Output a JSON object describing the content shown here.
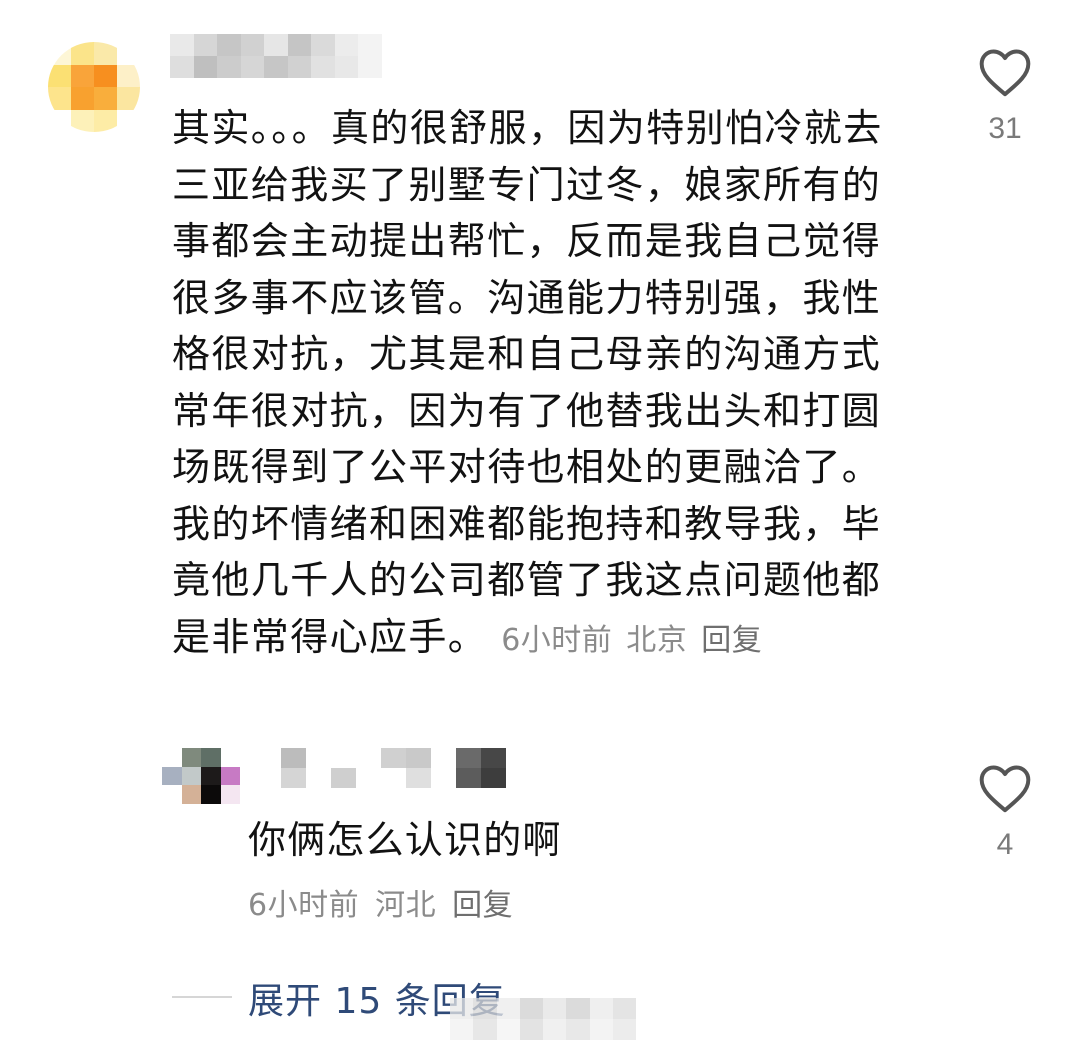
{
  "comments": [
    {
      "text": "其实。。。真的很舒服，因为特别怕冷就去三亚给我买了别墅专门过冬，娘家所有的事都会主动提出帮忙，反而是我自己觉得很多事不应该管。沟通能力特别强，我性格很对抗，尤其是和自己母亲的沟通方式常年很对抗，因为有了他替我出头和打圆场既得到了公平对待也相处的更融洽了。我的坏情绪和困难都能抱持和教导我，毕竟他几千人的公司都管了我这点问题他都是非常得心应手。",
      "time": "6小时前",
      "location": "北京",
      "reply_label": "回复",
      "likes": "31",
      "like_icon": "heart-outline-icon",
      "avatar_pixels": [
        "#fdf6d6",
        "#fbe48a",
        "#fae9a9",
        "#ffffff",
        "#fbe073",
        "#f9a43a",
        "#f78f1f",
        "#fdf0c8",
        "#fde48c",
        "#f8a12f",
        "#f9ae3c",
        "#fbe6a0",
        "#ffffff",
        "#fdf1b9",
        "#fdeca6",
        "#ffffff"
      ],
      "username_pixels": [
        "#e6e6e6",
        "#cfcfcf",
        "#bdbdbd",
        "#c9c9c9",
        "#e2e2e2",
        "#bcbcbc",
        "#d4d4d4",
        "#e9e9e9",
        "#f2f2f2",
        "#d9d9d9",
        "#b5b5b5",
        "#c4c4c4",
        "#d0d0d0",
        "#bdbdbd",
        "#cacaca",
        "#dcdcdc",
        "#e4e4e4",
        "#f2f2f2"
      ]
    },
    {
      "text": "你俩怎么认识的啊",
      "time": "6小时前",
      "location": "河北",
      "reply_label": "回复",
      "likes": "4",
      "like_icon": "heart-outline-icon",
      "avatar_pixels": [
        "#ffffff",
        "#7f8a7d",
        "#5f6f66",
        "#ffffff",
        "#a7b0c0",
        "#c2c9c9",
        "#1d1a1a",
        "#c77ac4",
        "#ffffff",
        "#d4b197",
        "#0c0a0a",
        "#f4e6f1"
      ],
      "username_pixels": [
        "#ffffff",
        "#bcbcbc",
        "#ffffff",
        "#ffffff",
        "#ffffff",
        "#d0d0d0",
        "#c9c9c9",
        "#ffffff",
        "#6a6a6a",
        "#474747",
        "#ffffff",
        "#d5d5d5",
        "#ffffff",
        "#cfcfcf",
        "#ffffff",
        "#ffffff",
        "#dfdfdf",
        "#ffffff",
        "#5c5c5c",
        "#3d3d3d"
      ]
    }
  ],
  "expand_label": "展开 15 条回复",
  "colors": {
    "text": "#121212",
    "meta": "#8b8b8b",
    "link": "#2f4a78",
    "icon": "#555555"
  },
  "watermark_pixels": [
    "#e9e9e9",
    "#d8d8d8",
    "#ececec",
    "#cfcfcf",
    "#e4e4e4",
    "#d0d0d0",
    "#eaeaea",
    "#dcdcdc",
    "#f1f1f1",
    "#e0e0e0",
    "#f3f3f3",
    "#dadada",
    "#ececec",
    "#e1e1e1",
    "#f0f0f0",
    "#e6e6e6"
  ]
}
